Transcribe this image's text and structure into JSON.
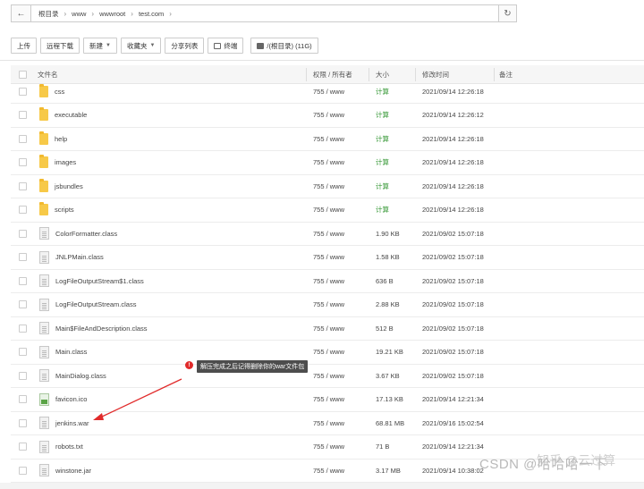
{
  "pathbar": {
    "crumbs": [
      "根目录",
      "www",
      "wwwroot",
      "test.com"
    ]
  },
  "toolbar": {
    "upload": "上传",
    "remote_download": "远程下载",
    "new": "新建",
    "favorites": "收藏夹",
    "share_list": "分享列表",
    "terminal": "终端",
    "disk": "/(根目录) (11G)"
  },
  "table": {
    "headers": {
      "name": "文件名",
      "perm": "权限 / 所有者",
      "size": "大小",
      "time": "修改时间",
      "note": "备注"
    },
    "rows": [
      {
        "name": "css",
        "type": "folder",
        "perm": "755 / www",
        "size": "计算",
        "time": "2021/09/14 12:26:18"
      },
      {
        "name": "executable",
        "type": "folder",
        "perm": "755 / www",
        "size": "计算",
        "time": "2021/09/14 12:26:12"
      },
      {
        "name": "help",
        "type": "folder",
        "perm": "755 / www",
        "size": "计算",
        "time": "2021/09/14 12:26:18"
      },
      {
        "name": "images",
        "type": "folder",
        "perm": "755 / www",
        "size": "计算",
        "time": "2021/09/14 12:26:18"
      },
      {
        "name": "jsbundles",
        "type": "folder",
        "perm": "755 / www",
        "size": "计算",
        "time": "2021/09/14 12:26:18"
      },
      {
        "name": "scripts",
        "type": "folder",
        "perm": "755 / www",
        "size": "计算",
        "time": "2021/09/14 12:26:18"
      },
      {
        "name": "ColorFormatter.class",
        "type": "file",
        "perm": "755 / www",
        "size": "1.90 KB",
        "time": "2021/09/02 15:07:18"
      },
      {
        "name": "JNLPMain.class",
        "type": "file",
        "perm": "755 / www",
        "size": "1.58 KB",
        "time": "2021/09/02 15:07:18"
      },
      {
        "name": "LogFileOutputStream$1.class",
        "type": "file",
        "perm": "755 / www",
        "size": "636 B",
        "time": "2021/09/02 15:07:18"
      },
      {
        "name": "LogFileOutputStream.class",
        "type": "file",
        "perm": "755 / www",
        "size": "2.88 KB",
        "time": "2021/09/02 15:07:18"
      },
      {
        "name": "Main$FileAndDescription.class",
        "type": "file",
        "perm": "755 / www",
        "size": "512 B",
        "time": "2021/09/02 15:07:18"
      },
      {
        "name": "Main.class",
        "type": "file",
        "perm": "755 / www",
        "size": "19.21 KB",
        "time": "2021/09/02 15:07:18"
      },
      {
        "name": "MainDialog.class",
        "type": "file",
        "perm": "755 / www",
        "size": "3.67 KB",
        "time": "2021/09/02 15:07:18"
      },
      {
        "name": "favicon.ico",
        "type": "ico",
        "perm": "755 / www",
        "size": "17.13 KB",
        "time": "2021/09/14 12:21:34"
      },
      {
        "name": "jenkins.war",
        "type": "file",
        "perm": "755 / www",
        "size": "68.81 MB",
        "time": "2021/09/16 15:02:54"
      },
      {
        "name": "robots.txt",
        "type": "file",
        "perm": "755 / www",
        "size": "71 B",
        "time": "2021/09/14 12:21:34"
      },
      {
        "name": "winstone.jar",
        "type": "file",
        "perm": "755 / www",
        "size": "3.17 MB",
        "time": "2021/09/14 10:38:02"
      }
    ]
  },
  "annotation": {
    "badge": "!",
    "text": "解压完成之后记得删除你的war文件包"
  },
  "watermark": {
    "top": "知乎 @云过算",
    "bottom": "CSDN @哈哈哈一下"
  },
  "colors": {
    "calc_green": "#3a9a3a",
    "folder_yellow": "#f7c948",
    "annotation_red": "#e12b2b"
  }
}
